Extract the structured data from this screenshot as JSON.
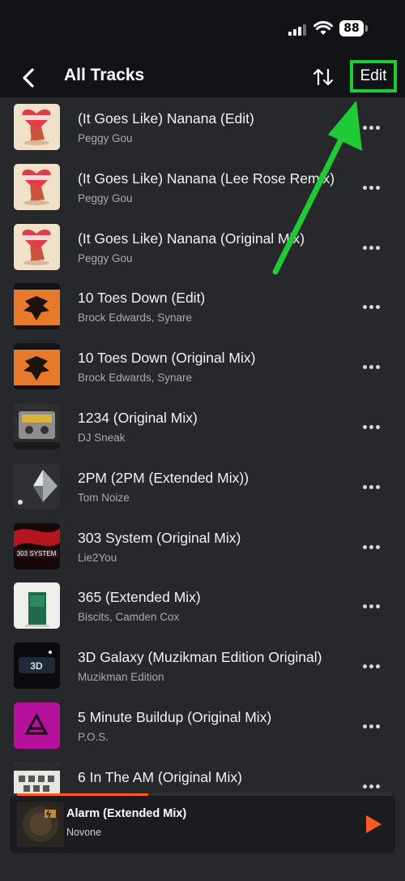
{
  "status_bar": {
    "battery_level": "88"
  },
  "header": {
    "title": "All Tracks",
    "edit_label": "Edit"
  },
  "tracks": [
    {
      "title": "(It Goes Like) Nanana (Edit)",
      "artist": "Peggy Gou",
      "art": "peggy"
    },
    {
      "title": "(It Goes Like) Nanana (Lee Rose Remix)",
      "artist": "Peggy Gou",
      "art": "peggy"
    },
    {
      "title": "(It Goes Like) Nanana (Original Mix)",
      "artist": "Peggy Gou",
      "art": "peggy"
    },
    {
      "title": "10 Toes Down (Edit)",
      "artist": "Brock Edwards, Synare",
      "art": "phoenix"
    },
    {
      "title": "10 Toes Down (Original Mix)",
      "artist": "Brock Edwards, Synare",
      "art": "phoenix"
    },
    {
      "title": "1234 (Original Mix)",
      "artist": "DJ Sneak",
      "art": "cassette"
    },
    {
      "title": "2PM (2PM (Extended Mix))",
      "artist": "Tom Noize",
      "art": "geo"
    },
    {
      "title": "303 System (Original Mix)",
      "artist": "Lie2You",
      "art": "system303"
    },
    {
      "title": "365 (Extended Mix)",
      "artist": "Biscits, Camden Cox",
      "art": "door"
    },
    {
      "title": "3D Galaxy (Muzikman Edition Original)",
      "artist": "Muzikman Edition",
      "art": "galaxy"
    },
    {
      "title": "5 Minute Buildup (Original Mix)",
      "artist": "P.O.S.",
      "art": "anjuna"
    },
    {
      "title": "6 In The AM (Original Mix)",
      "artist": "",
      "art": "pattern"
    }
  ],
  "now_playing": {
    "title": "Alarm (Extended Mix)",
    "artist": "Novone",
    "progress_fraction": 0.34,
    "accent_color": "#ff5a1f"
  },
  "colors": {
    "background": "#26282b",
    "header": "#121316",
    "highlight": "#1ecb35",
    "accent": "#ff5a1f"
  },
  "icons": [
    "chevron-left-icon",
    "sort-icon",
    "more-icon",
    "play-icon",
    "wifi-icon",
    "signal-icon",
    "battery-icon"
  ]
}
